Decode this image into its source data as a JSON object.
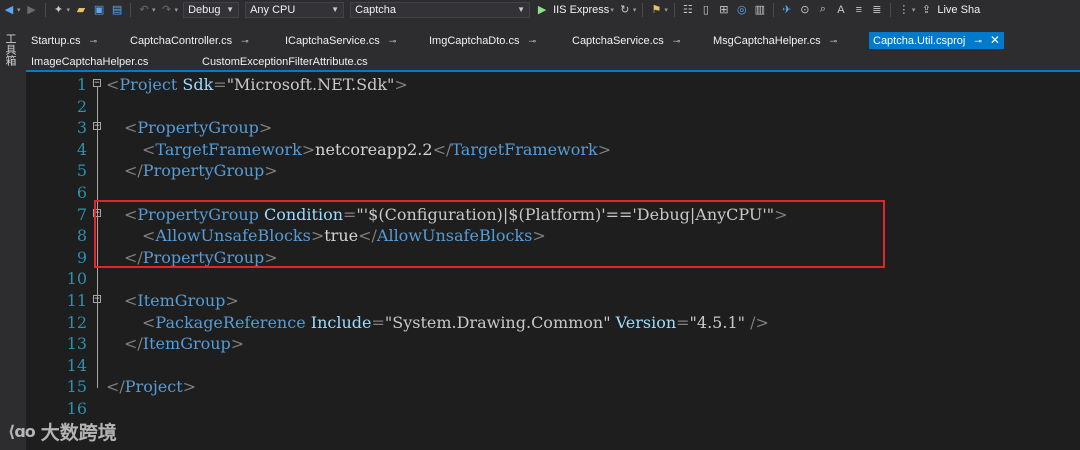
{
  "toolbar": {
    "config": "Debug",
    "platform": "Any CPU",
    "project": "Captcha",
    "run_label": "IIS Express",
    "live_share": "Live Sha"
  },
  "side": {
    "toolbox_label": "工具箱"
  },
  "tabs_row1": [
    {
      "label": "Startup.cs"
    },
    {
      "label": "CaptchaController.cs"
    },
    {
      "label": "ICaptchaService.cs"
    },
    {
      "label": "ImgCaptchaDto.cs"
    },
    {
      "label": "CaptchaService.cs"
    },
    {
      "label": "MsgCaptchaHelper.cs"
    },
    {
      "label": "Captcha.Util.csproj"
    }
  ],
  "tabs_row2": [
    {
      "label": "ImageCaptchaHelper.cs"
    },
    {
      "label": "CustomExceptionFilterAttribute.cs"
    }
  ],
  "editor": {
    "line_numbers": [
      "1",
      "2",
      "3",
      "4",
      "5",
      "6",
      "7",
      "8",
      "9",
      "10",
      "11",
      "12",
      "13",
      "14",
      "15",
      "16"
    ],
    "l1": {
      "tag": "Project",
      "attr": "Sdk",
      "value": "\"Microsoft.NET.Sdk\""
    },
    "l3": {
      "tag": "PropertyGroup"
    },
    "l4": {
      "tag": "TargetFramework",
      "text": "netcoreapp2.2"
    },
    "l5": {
      "tag": "PropertyGroup"
    },
    "l7": {
      "tag": "PropertyGroup",
      "attr": "Condition",
      "value": "\"'$(Configuration)|$(Platform)'=='Debug|AnyCPU'\""
    },
    "l8": {
      "tag": "AllowUnsafeBlocks",
      "text": "true"
    },
    "l9": {
      "tag": "PropertyGroup"
    },
    "l11": {
      "tag": "ItemGroup"
    },
    "l12": {
      "tag": "PackageReference",
      "attr1": "Include",
      "value1": "\"System.Drawing.Common\"",
      "attr2": "Version",
      "value2": "\"4.5.1\""
    },
    "l13": {
      "tag": "ItemGroup"
    },
    "l15": {
      "tag": "Project"
    }
  },
  "watermark": {
    "text": "大数跨境"
  }
}
